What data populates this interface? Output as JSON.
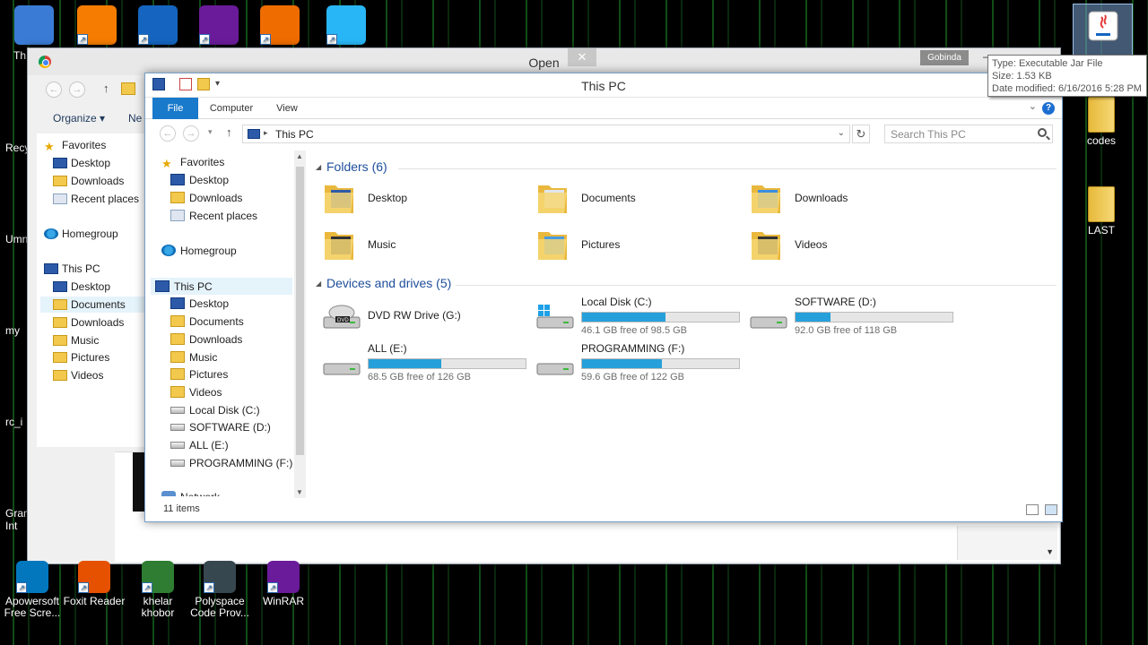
{
  "desktop_icons_left": [
    {
      "name": "this-pc",
      "label": "Th",
      "color": "#3a7bd5"
    },
    {
      "name": "avast",
      "label": "",
      "color": "#f57c00"
    },
    {
      "name": "app-blue",
      "label": "",
      "color": "#1565c0"
    },
    {
      "name": "app-purple",
      "label": "",
      "color": "#6a1b9a"
    },
    {
      "name": "app-orange",
      "label": "",
      "color": "#ef6c00"
    },
    {
      "name": "shareit",
      "label": "",
      "color": "#29b6f6"
    }
  ],
  "desktop_side_labels": [
    "Recy",
    "Umn",
    "my",
    "rc_i",
    "Gram",
    "Int"
  ],
  "desktop_right_icons": [
    {
      "label": "codes"
    },
    {
      "label": "LAST"
    }
  ],
  "taskbar_icons": [
    {
      "label1": "Apowersoft",
      "label2": "Free Scre...",
      "color": "#0277bd"
    },
    {
      "label1": "Foxit Reader",
      "label2": "",
      "color": "#e65100"
    },
    {
      "label1": "khelar",
      "label2": "khobor",
      "color": "#2e7d32"
    },
    {
      "label1": "Polyspace",
      "label2": "Code Prov...",
      "color": "#37474f"
    },
    {
      "label1": "WinRAR",
      "label2": "",
      "color": "#6a1b9a"
    }
  ],
  "tooltip": {
    "type": "Type: Executable Jar File",
    "size": "Size: 1.53 KB",
    "modified": "Date modified: 6/16/2016 5:28 PM"
  },
  "open_dialog": {
    "title": "Open",
    "close": "✕",
    "user": "Gobinda",
    "toolbar": {
      "organize": "Organize ▾",
      "new": "Ne"
    },
    "sidebar": [
      {
        "label": "Favorites",
        "icon": "star-icon"
      },
      {
        "label": "Desktop",
        "icon": "desktop-icon"
      },
      {
        "label": "Downloads",
        "icon": "folder-icon"
      },
      {
        "label": "Recent places",
        "icon": "recent-icon"
      },
      {
        "label": "Homegroup",
        "icon": "homegroup-icon"
      },
      {
        "label": "This PC",
        "icon": "computer-icon"
      },
      {
        "label": "Desktop",
        "icon": "desktop-icon"
      },
      {
        "label": "Documents",
        "icon": "folder-icon"
      },
      {
        "label": "Downloads",
        "icon": "folder-icon"
      },
      {
        "label": "Music",
        "icon": "folder-icon"
      },
      {
        "label": "Pictures",
        "icon": "folder-icon"
      },
      {
        "label": "Videos",
        "icon": "folder-icon"
      }
    ]
  },
  "explorer": {
    "title": "This PC",
    "tabs": {
      "file": "File",
      "computer": "Computer",
      "view": "View"
    },
    "address": {
      "path": "This PC"
    },
    "search": {
      "placeholder": "Search This PC"
    },
    "nav": [
      {
        "label": "Favorites",
        "icon": "star-icon"
      },
      {
        "label": "Desktop",
        "icon": "desktop-icon"
      },
      {
        "label": "Downloads",
        "icon": "folder-icon"
      },
      {
        "label": "Recent places",
        "icon": "recent-icon"
      },
      {
        "label": "Homegroup",
        "icon": "homegroup-icon"
      },
      {
        "label": "This PC",
        "icon": "computer-icon"
      },
      {
        "label": "Desktop",
        "icon": "desktop-icon"
      },
      {
        "label": "Documents",
        "icon": "folder-icon"
      },
      {
        "label": "Downloads",
        "icon": "folder-icon"
      },
      {
        "label": "Music",
        "icon": "folder-icon"
      },
      {
        "label": "Pictures",
        "icon": "folder-icon"
      },
      {
        "label": "Videos",
        "icon": "folder-icon"
      },
      {
        "label": "Local Disk (C:)",
        "icon": "drive-icon"
      },
      {
        "label": "SOFTWARE (D:)",
        "icon": "drive-icon"
      },
      {
        "label": "ALL (E:)",
        "icon": "drive-icon"
      },
      {
        "label": "PROGRAMMING (F:)",
        "icon": "drive-icon"
      },
      {
        "label": "Network",
        "icon": "network-icon"
      }
    ],
    "folders_header": "Folders (6)",
    "folders": [
      "Desktop",
      "Documents",
      "Downloads",
      "Music",
      "Pictures",
      "Videos"
    ],
    "drives_header": "Devices and drives (5)",
    "drives": [
      {
        "name": "DVD RW Drive (G:)",
        "free": "",
        "used_fraction": null,
        "kind": "dvd"
      },
      {
        "name": "Local Disk (C:)",
        "free": "46.1 GB free of 98.5 GB",
        "used_fraction": 0.53,
        "kind": "system"
      },
      {
        "name": "SOFTWARE (D:)",
        "free": "92.0 GB free of 118 GB",
        "used_fraction": 0.22,
        "kind": "disk"
      },
      {
        "name": "ALL (E:)",
        "free": "68.5 GB free of 126 GB",
        "used_fraction": 0.46,
        "kind": "disk"
      },
      {
        "name": "PROGRAMMING (F:)",
        "free": "59.6 GB free of 122 GB",
        "used_fraction": 0.51,
        "kind": "disk"
      }
    ],
    "status": "11 items"
  },
  "colors": {
    "accent": "#1979ca",
    "drive_fill": "#26a0da",
    "group_header": "#1e4e9b"
  }
}
